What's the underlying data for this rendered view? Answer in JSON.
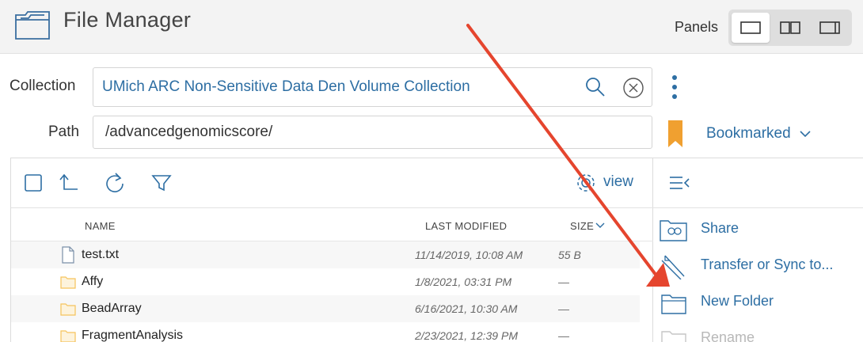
{
  "app": {
    "title": "File Manager"
  },
  "panels": {
    "label": "Panels",
    "options": [
      "single-panel-icon",
      "double-panel-icon",
      "sidebar-panel-icon"
    ],
    "selected": 0
  },
  "collection": {
    "label": "Collection",
    "value": "UMich ARC Non-Sensitive Data Den Volume Collection"
  },
  "path": {
    "label": "Path",
    "value": "/advancedgenomicscore/"
  },
  "bookmark": {
    "label": "Bookmarked"
  },
  "toolbar": {
    "view_label": "view"
  },
  "table": {
    "columns": {
      "name": "NAME",
      "modified": "LAST MODIFIED",
      "size": "SIZE"
    },
    "rows": [
      {
        "type": "file",
        "name": "test.txt",
        "modified": "11/14/2019, 10:08 AM",
        "size": "55 B"
      },
      {
        "type": "folder",
        "name": "Affy",
        "modified": "1/8/2021, 03:31 PM",
        "size": "—"
      },
      {
        "type": "folder",
        "name": "BeadArray",
        "modified": "6/16/2021, 10:30 AM",
        "size": "—"
      },
      {
        "type": "folder",
        "name": "FragmentAnalysis",
        "modified": "2/23/2021, 12:39 PM",
        "size": "—"
      }
    ]
  },
  "actions": [
    {
      "label": "Share",
      "icon": "share-folder-icon",
      "enabled": true
    },
    {
      "label": "Transfer or Sync to...",
      "icon": "transfer-arrows-icon",
      "enabled": true
    },
    {
      "label": "New Folder",
      "icon": "new-folder-icon",
      "enabled": true
    },
    {
      "label": "Rename",
      "icon": "rename-icon",
      "enabled": false
    }
  ],
  "colors": {
    "link": "#2d6ea3",
    "bookmark": "#f0a030",
    "annotation_arrow": "#e5452e",
    "folder": "#f6c35b"
  }
}
